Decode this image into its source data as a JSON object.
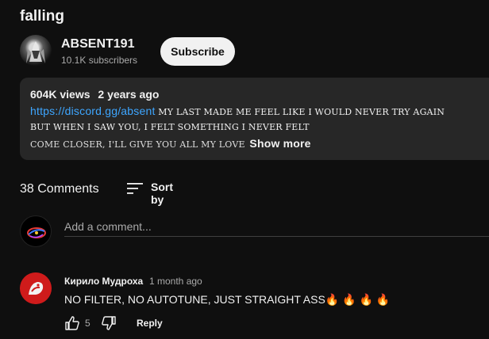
{
  "video": {
    "title": "falling"
  },
  "channel": {
    "name": "ABSENT191",
    "subscribers": "10.1K subscribers",
    "subscribe_label": "Subscribe"
  },
  "description": {
    "views": "604K views",
    "age": "2 years ago",
    "link": "https://discord.gg/absent",
    "line1_text": "MY LAST MADE ME FEEL LIKE I WOULD NEVER TRY AGAIN",
    "line2_text": "BUT WHEN I SAW YOU, I FELT SOMETHING I NEVER FELT",
    "line3_text": "COME CLOSER, I'LL GIVE YOU ALL MY LOVE",
    "show_more": "Show more"
  },
  "comments": {
    "count_label": "38 Comments",
    "sort_label": "Sort by",
    "add_placeholder": "Add a comment...",
    "items": [
      {
        "author": "Кирило Мудроха",
        "time": "1 month ago",
        "text": "NO FILTER, NO AUTOTUNE, JUST STRAIGHT ASS🔥 🔥 🔥 🔥",
        "likes": "5",
        "reply_label": "Reply"
      }
    ]
  },
  "icons": {
    "sort": "sort-icon",
    "like": "thumb-up-icon",
    "dislike": "thumb-down-icon"
  },
  "colors": {
    "background": "#0f0f0f",
    "card": "#272727",
    "link": "#3ea6ff",
    "secondary_text": "#aaaaaa",
    "subscribe_bg": "#f1f1f1"
  }
}
